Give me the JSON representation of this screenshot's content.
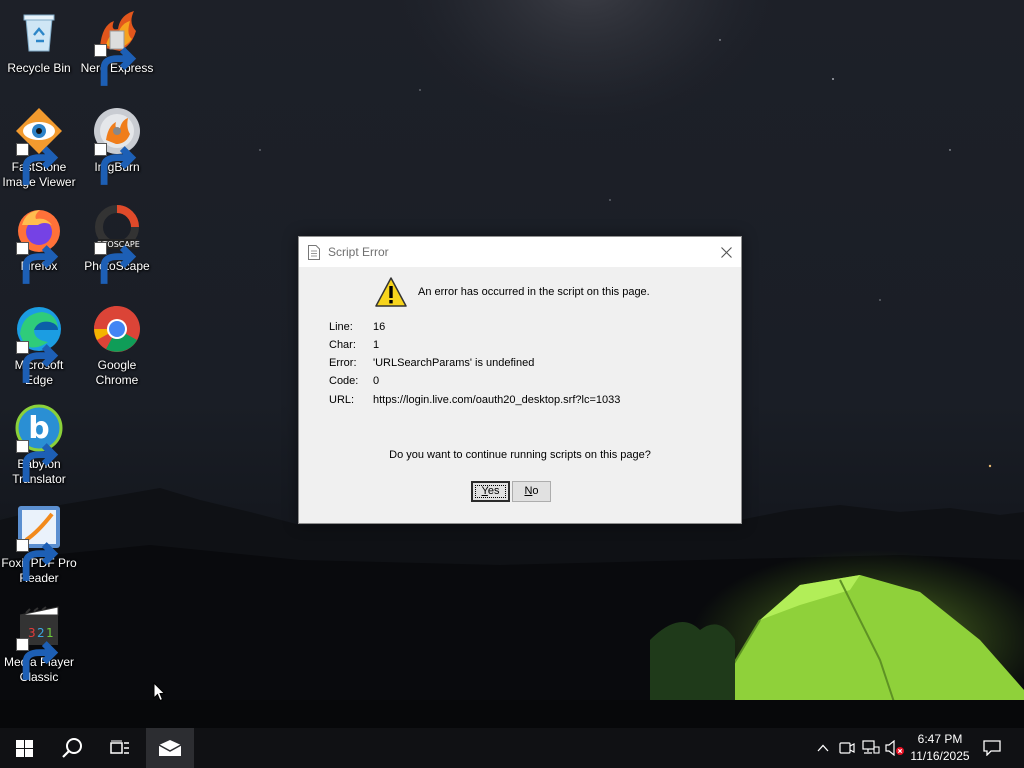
{
  "desktop": {
    "icons": [
      {
        "label": "Recycle Bin",
        "icon": "recycle-bin-icon"
      },
      {
        "label": "Nero Express",
        "icon": "nero-express-icon"
      },
      {
        "label": "FastStone\nImage Viewer",
        "icon": "faststone-icon"
      },
      {
        "label": "ImgBurn",
        "icon": "imgburn-icon"
      },
      {
        "label": "Firefox",
        "icon": "firefox-icon"
      },
      {
        "label": "PhotoScape",
        "icon": "photoscape-icon"
      },
      {
        "label": "Microsoft\nEdge",
        "icon": "edge-icon"
      },
      {
        "label": "Google\nChrome",
        "icon": "chrome-icon"
      },
      {
        "label": "Babylon\nTranslator",
        "icon": "babylon-icon"
      },
      {
        "label": "Foxit PDF Pro\nReader",
        "icon": "foxit-icon"
      },
      {
        "label": "Media Player\nClassic",
        "icon": "media-player-classic-icon"
      }
    ],
    "photoscape_badge": "OTOSCAPE"
  },
  "dialog": {
    "title": "Script Error",
    "message": "An error has occurred in the script on this page.",
    "rows": [
      {
        "key": "Line:",
        "value": "16"
      },
      {
        "key": "Char:",
        "value": "1"
      },
      {
        "key": "Error:",
        "value": "'URLSearchParams' is undefined"
      },
      {
        "key": "Code:",
        "value": "0"
      },
      {
        "key": "URL:",
        "value": "https://login.live.com/oauth20_desktop.srf?lc=1033"
      }
    ],
    "question": "Do you want to continue running scripts on this page?",
    "yes_label_access": "Y",
    "yes_label_rest": "es",
    "no_label_access": "N",
    "no_label_rest": "o"
  },
  "taskbar": {
    "time": "6:47 PM",
    "date": "11/16/2025",
    "icons": [
      "windows-start-icon",
      "search-icon",
      "task-view-icon",
      "mail-icon"
    ],
    "tray_icons": [
      "chevron-up-icon",
      "meet-now-icon",
      "network-icon",
      "volume-muted-icon",
      "notification-icon"
    ]
  },
  "colors": {
    "taskbar": "#101114",
    "dialog_bg": "#f0f0f0",
    "tent_green": "#8fd13a"
  }
}
